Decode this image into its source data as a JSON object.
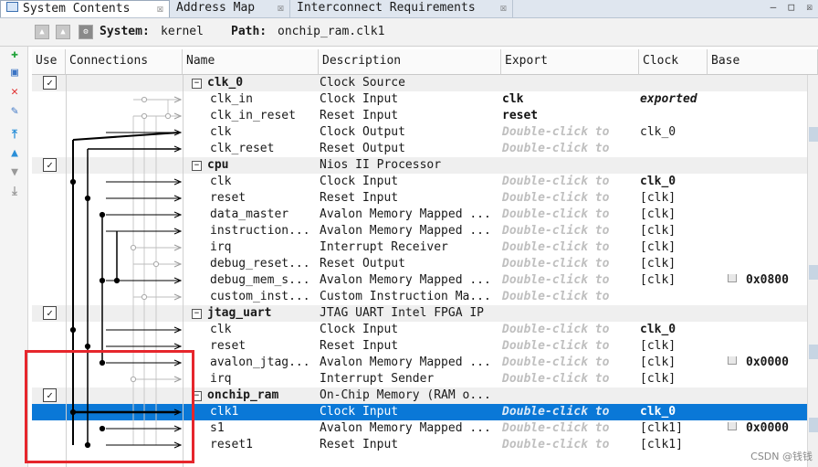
{
  "tabs": [
    {
      "label": "System Contents",
      "active": true
    },
    {
      "label": "Address Map",
      "active": false
    },
    {
      "label": "Interconnect Requirements",
      "active": false
    }
  ],
  "toolbar": {
    "system_label": "System:",
    "system_value": "kernel",
    "path_label": "Path:",
    "path_value": "onchip_ram.clk1"
  },
  "columns": {
    "use": "Use",
    "connections": "Connections",
    "name": "Name",
    "description": "Description",
    "export": "Export",
    "clock": "Clock",
    "base": "Base"
  },
  "rows": [
    {
      "kind": "module",
      "name": "clk_0",
      "desc": "Clock Source",
      "export": "",
      "clock": "",
      "base": "",
      "checked": true
    },
    {
      "kind": "port",
      "name": "clk_in",
      "desc": "Clock Input",
      "export": "clk",
      "clock": "exported",
      "base": ""
    },
    {
      "kind": "port",
      "name": "clk_in_reset",
      "desc": "Reset Input",
      "export": "reset",
      "clock": "",
      "base": ""
    },
    {
      "kind": "port",
      "name": "clk",
      "desc": "Clock Output",
      "export": "Double-click to",
      "clock": "clk_0",
      "base": ""
    },
    {
      "kind": "port",
      "name": "clk_reset",
      "desc": "Reset Output",
      "export": "Double-click to",
      "clock": "",
      "base": ""
    },
    {
      "kind": "module",
      "name": "cpu",
      "desc": "Nios II Processor",
      "export": "",
      "clock": "",
      "base": "",
      "checked": true
    },
    {
      "kind": "port",
      "name": "clk",
      "desc": "Clock Input",
      "export": "Double-click to",
      "clock": "clk_0",
      "base": ""
    },
    {
      "kind": "port",
      "name": "reset",
      "desc": "Reset Input",
      "export": "Double-click to",
      "clock": "[clk]",
      "base": ""
    },
    {
      "kind": "port",
      "name": "data_master",
      "desc": "Avalon Memory Mapped ...",
      "export": "Double-click to",
      "clock": "[clk]",
      "base": ""
    },
    {
      "kind": "port",
      "name": "instruction...",
      "desc": "Avalon Memory Mapped ...",
      "export": "Double-click to",
      "clock": "[clk]",
      "base": ""
    },
    {
      "kind": "port",
      "name": "irq",
      "desc": "Interrupt Receiver",
      "export": "Double-click to",
      "clock": "[clk]",
      "base": ""
    },
    {
      "kind": "port",
      "name": "debug_reset...",
      "desc": "Reset Output",
      "export": "Double-click to",
      "clock": "[clk]",
      "base": ""
    },
    {
      "kind": "port",
      "name": "debug_mem_s...",
      "desc": "Avalon Memory Mapped ...",
      "export": "Double-click to",
      "clock": "[clk]",
      "base": "0x0800"
    },
    {
      "kind": "port",
      "name": "custom_inst...",
      "desc": "Custom Instruction Ma...",
      "export": "Double-click to",
      "clock": "",
      "base": ""
    },
    {
      "kind": "module",
      "name": "jtag_uart",
      "desc": "JTAG UART Intel FPGA IP",
      "export": "",
      "clock": "",
      "base": "",
      "checked": true
    },
    {
      "kind": "port",
      "name": "clk",
      "desc": "Clock Input",
      "export": "Double-click to",
      "clock": "clk_0",
      "base": ""
    },
    {
      "kind": "port",
      "name": "reset",
      "desc": "Reset Input",
      "export": "Double-click to",
      "clock": "[clk]",
      "base": ""
    },
    {
      "kind": "port",
      "name": "avalon_jtag...",
      "desc": "Avalon Memory Mapped ...",
      "export": "Double-click to",
      "clock": "[clk]",
      "base": "0x0000"
    },
    {
      "kind": "port",
      "name": "irq",
      "desc": "Interrupt Sender",
      "export": "Double-click to",
      "clock": "[clk]",
      "base": ""
    },
    {
      "kind": "module",
      "name": "onchip_ram",
      "desc": "On-Chip Memory (RAM o...",
      "export": "",
      "clock": "",
      "base": "",
      "checked": true
    },
    {
      "kind": "port",
      "name": "clk1",
      "desc": "Clock Input",
      "export": "Double-click to",
      "clock": "clk_0",
      "base": "",
      "selected": true
    },
    {
      "kind": "port",
      "name": "s1",
      "desc": "Avalon Memory Mapped ...",
      "export": "Double-click to",
      "clock": "[clk1]",
      "base": "0x0000"
    },
    {
      "kind": "port",
      "name": "reset1",
      "desc": "Reset Input",
      "export": "Double-click to",
      "clock": "[clk1]",
      "base": ""
    }
  ],
  "watermark": "CSDN @钱钱"
}
